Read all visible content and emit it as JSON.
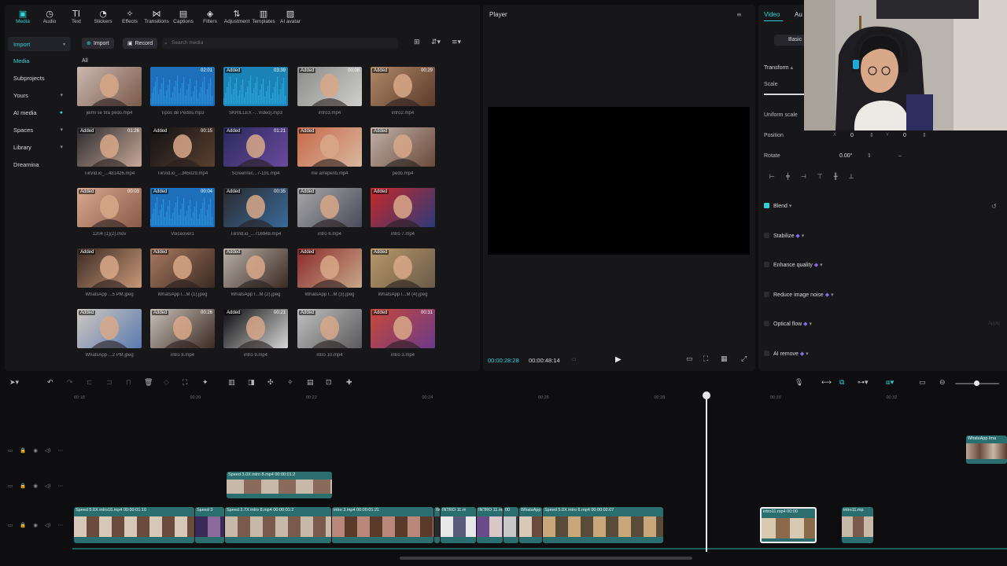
{
  "toolbar_tabs": [
    {
      "label": "Media",
      "icon": "media-icon",
      "glyph": "▣"
    },
    {
      "label": "Audio",
      "icon": "audio-icon",
      "glyph": "◷"
    },
    {
      "label": "Text",
      "icon": "text-icon",
      "glyph": "TI"
    },
    {
      "label": "Stickers",
      "icon": "stickers-icon",
      "glyph": "◔"
    },
    {
      "label": "Effects",
      "icon": "effects-icon",
      "glyph": "✧"
    },
    {
      "label": "Transitions",
      "icon": "transitions-icon",
      "glyph": "⋈"
    },
    {
      "label": "Captions",
      "icon": "captions-icon",
      "glyph": "▤"
    },
    {
      "label": "Filters",
      "icon": "filters-icon",
      "glyph": "◈"
    },
    {
      "label": "Adjustment",
      "icon": "adjustment-icon",
      "glyph": "⇅"
    },
    {
      "label": "Templates",
      "icon": "templates-icon",
      "glyph": "▥"
    },
    {
      "label": "AI avatar",
      "icon": "ai-avatar-icon",
      "glyph": "▨"
    }
  ],
  "sidebar": {
    "import_header": "Import",
    "items": [
      {
        "label": "Media",
        "active": true,
        "dropdown": false
      },
      {
        "label": "Subprojects",
        "active": false,
        "dropdown": false
      },
      {
        "label": "Yours",
        "active": false,
        "dropdown": true
      },
      {
        "label": "AI media",
        "active": false,
        "dropdown": true
      },
      {
        "label": "Spaces",
        "active": false,
        "dropdown": true
      },
      {
        "label": "Library",
        "active": false,
        "dropdown": true
      },
      {
        "label": "Dreamina",
        "active": false,
        "dropdown": false
      }
    ]
  },
  "media_toolbar": {
    "import_label": "Import",
    "record_label": "Record",
    "search_placeholder": "Search media",
    "filter_all": "All"
  },
  "media_items": [
    {
      "name": "jeimi se tira pedo.mp4",
      "added": false,
      "duration": "",
      "colors": [
        "#c9b8b0",
        "#7b5a4a"
      ]
    },
    {
      "name": "Tipos de Pedos.mp3",
      "added": false,
      "duration": "02:01",
      "colors": [
        "#1c6fb8",
        "#2b8fd8"
      ],
      "audio": true
    },
    {
      "name": "SKRILLEX -...Video).mp3",
      "added": true,
      "duration": "03:39",
      "colors": [
        "#1a82b5",
        "#2aa3d8"
      ],
      "audio": true
    },
    {
      "name": "intro3.mp4",
      "added": true,
      "duration": "00:08",
      "colors": [
        "#8a8a86",
        "#cfcfcf"
      ]
    },
    {
      "name": "intro2.mp4",
      "added": true,
      "duration": "00:29",
      "colors": [
        "#b08868",
        "#5a3a2a"
      ]
    },
    {
      "name": "TikVid.io_...481426.mp4",
      "added": true,
      "duration": "01:26",
      "colors": [
        "#2a2a2e",
        "#c8a898"
      ]
    },
    {
      "name": "TikVid.io_...345029.mp4",
      "added": true,
      "duration": "00:15",
      "colors": [
        "#111113",
        "#5a4030"
      ]
    },
    {
      "name": "Screenrec...7-191.mp4",
      "added": true,
      "duration": "01:21",
      "colors": [
        "#2a2a5a",
        "#6a4aa0"
      ]
    },
    {
      "name": "me arrepenti.mp4",
      "added": true,
      "duration": "",
      "colors": [
        "#c86848",
        "#d8b8a0"
      ]
    },
    {
      "name": "pedo.mp4",
      "added": true,
      "duration": "",
      "colors": [
        "#c0b0a8",
        "#6a4a3a"
      ]
    },
    {
      "name": "1204 (1)(2).mov",
      "added": true,
      "duration": "00:03",
      "colors": [
        "#d8a890",
        "#8a5a48"
      ]
    },
    {
      "name": "Voiceover1",
      "added": true,
      "duration": "00:04",
      "colors": [
        "#1c6fb8",
        "#2b8fd8"
      ],
      "audio": true
    },
    {
      "name": "TikVid.io_...716948.mp4",
      "added": true,
      "duration": "00:35",
      "colors": [
        "#2a2a2e",
        "#3a6a9a"
      ]
    },
    {
      "name": "intro 6.mp4",
      "added": true,
      "duration": "",
      "colors": [
        "#a8a8a8",
        "#4a4a5a"
      ]
    },
    {
      "name": "intro 7.mp4",
      "added": true,
      "duration": "",
      "colors": [
        "#c82828",
        "#2a3a7a"
      ]
    },
    {
      "name": "WhatsApp ...5 PM.jpeg",
      "added": true,
      "duration": "",
      "colors": [
        "#3a2a22",
        "#c89878"
      ]
    },
    {
      "name": "WhatsApp I...M (1).jpeg",
      "added": true,
      "duration": "",
      "colors": [
        "#a87860",
        "#3a2a22"
      ]
    },
    {
      "name": "WhatsApp I...M (2).jpeg",
      "added": true,
      "duration": "",
      "colors": [
        "#b8b0a8",
        "#3a2a22"
      ]
    },
    {
      "name": "WhatsApp I...M (3).jpeg",
      "added": true,
      "duration": "",
      "colors": [
        "#8a2a2a",
        "#c8a888"
      ]
    },
    {
      "name": "WhatsApp I...M (4).jpeg",
      "added": true,
      "duration": "",
      "colors": [
        "#b89868",
        "#6a5a4a"
      ]
    },
    {
      "name": "WhatsApp ...2 PM.jpeg",
      "added": true,
      "duration": "",
      "colors": [
        "#d0c8c0",
        "#5a7ab0"
      ]
    },
    {
      "name": "intro 8.mp4",
      "added": true,
      "duration": "00:26",
      "colors": [
        "#c8c0b8",
        "#3a2a22"
      ]
    },
    {
      "name": "intro 9.mp4",
      "added": true,
      "duration": "00:21",
      "colors": [
        "#0a0a0c",
        "#d8d8d8"
      ]
    },
    {
      "name": "intro 10.mp4",
      "added": true,
      "duration": "",
      "colors": [
        "#c0c0c0",
        "#5a5a5a"
      ]
    },
    {
      "name": "intro 3.mp4",
      "added": true,
      "duration": "00:31",
      "colors": [
        "#c84838",
        "#6a3a8a"
      ]
    }
  ],
  "player": {
    "title": "Player",
    "current_time": "00:00:28:28",
    "total_time": "00:00:48:14"
  },
  "inspector": {
    "tabs": [
      "Video",
      "Au"
    ],
    "subtab": "Basic",
    "transform": "Transform",
    "scale_label": "Scale",
    "uniform_scale": "Uniform scale",
    "position_label": "Position",
    "pos_x_label": "X",
    "pos_x": "0",
    "pos_y_label": "Y",
    "pos_y": "0",
    "rotate_label": "Rotate",
    "rotate_value": "0.00°",
    "rotate_reset": "–",
    "sections": [
      {
        "label": "Blend",
        "checked": true,
        "premium": false
      },
      {
        "label": "Stabilize",
        "checked": false,
        "premium": true
      },
      {
        "label": "Enhance quality",
        "checked": false,
        "premium": true
      },
      {
        "label": "Reduce image noise",
        "checked": false,
        "premium": true
      },
      {
        "label": "Optical flow",
        "checked": false,
        "premium": true
      },
      {
        "label": "AI remove",
        "checked": false,
        "premium": true
      }
    ],
    "apply_label": "Apply"
  },
  "timeline": {
    "ruler": [
      "00:18",
      "00:20",
      "00:22",
      "00:24",
      "00:26",
      "00:28",
      "00:30",
      "00:32"
    ],
    "overlay_clip_label": "WhatsApp Ima",
    "track2_clip_label": "Speed 3.0X  intro 8.mp4  00:00:01:2",
    "main_clips": [
      {
        "label": "Speed 5.0X  intro10.mp4  00:00:01:10"
      },
      {
        "label": "Speed 3"
      },
      {
        "label": "Speed 2.7X  intro 8.mp4  00:00:01:2"
      },
      {
        "label": "intro 3.mp4  00:00:01:21"
      },
      {
        "label": "W"
      },
      {
        "label": "INTRO 11.m"
      },
      {
        "label": "INTRO 11.mp4"
      },
      {
        "label": "00"
      },
      {
        "label": "WhatsApp"
      },
      {
        "label": "Speed 5.0X  intro 6.mp4  00:00:02:07"
      }
    ],
    "selected_clip_label": "intro11.mp4  00:00",
    "tail_clip_label": "intro11.mp"
  },
  "colors": {
    "accent": "#2ed1d8",
    "panel": "#17171a",
    "bg": "#0e0e10",
    "clip": "#2a6e6f"
  }
}
